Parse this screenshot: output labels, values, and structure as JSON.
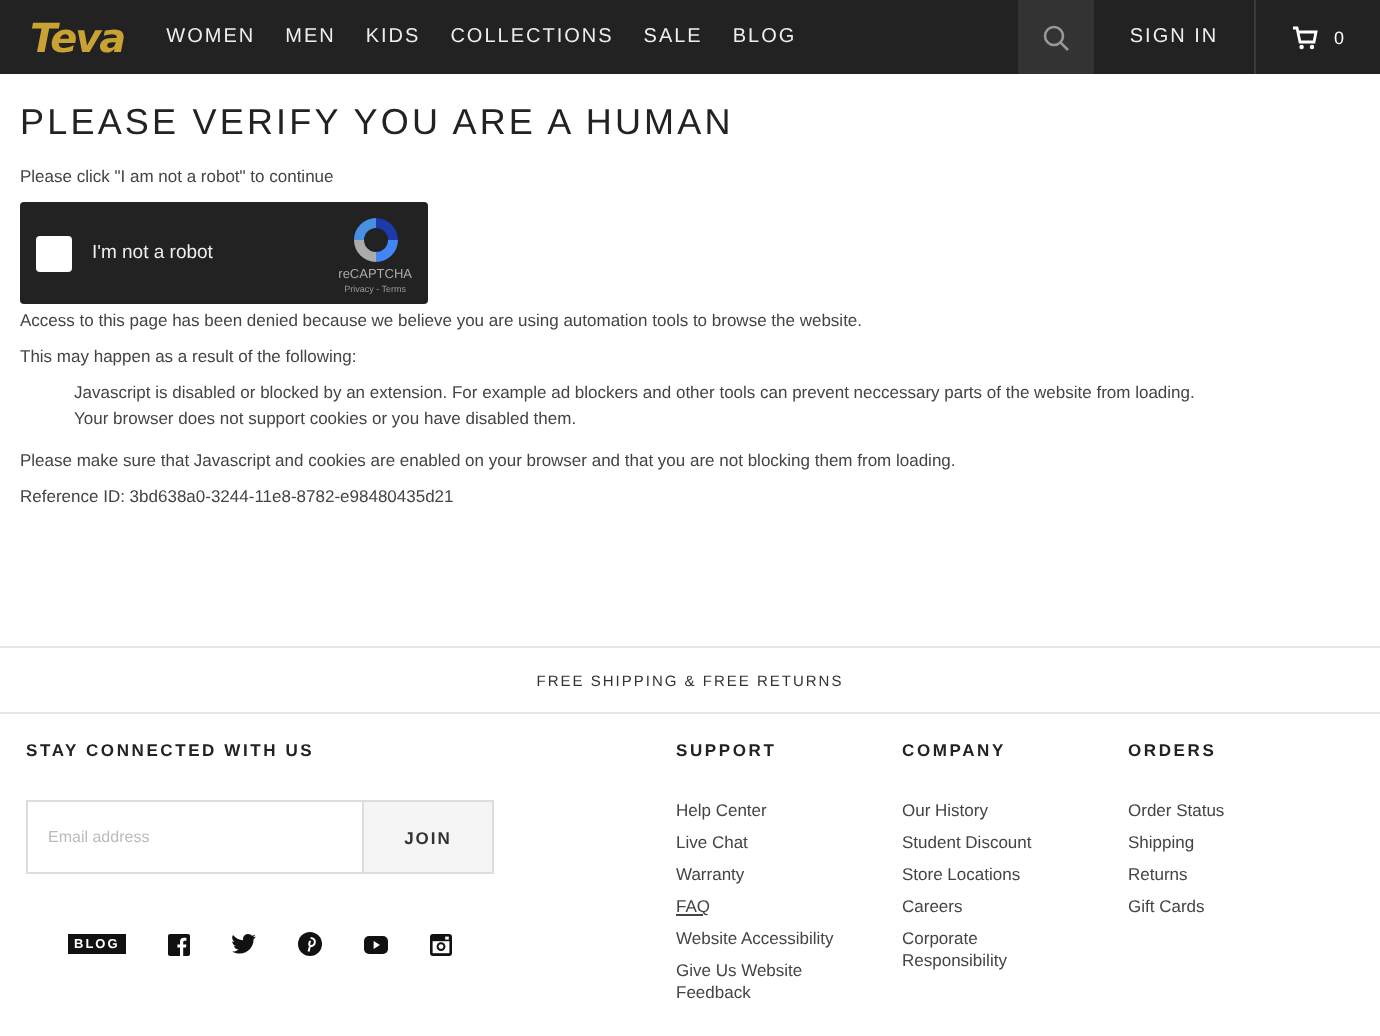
{
  "header": {
    "logo": "Teva",
    "nav": [
      "WOMEN",
      "MEN",
      "KIDS",
      "COLLECTIONS",
      "SALE",
      "BLOG"
    ],
    "sign_in": "SIGN IN",
    "cart_count": "0"
  },
  "main": {
    "title": "PLEASE VERIFY YOU ARE A HUMAN",
    "instruction": "Please click \"I am not a robot\" to continue",
    "captcha": {
      "label": "I'm not a robot",
      "checked": false,
      "brand": "reCAPTCHA",
      "links": "Privacy - Terms"
    },
    "denied": "Access to this page has been denied because we believe you are using automation tools to browse the website.",
    "reasons_intro": "This may happen as a result of the following:",
    "reasons": [
      "Javascript is disabled or blocked by an extension. For example ad blockers and other tools can prevent neccessary parts of the website from loading.",
      "Your browser does not support cookies or you have disabled them."
    ],
    "advice": "Please make sure that Javascript and cookies are enabled on your browser and that you are not blocking them from loading.",
    "reference": "Reference ID: 3bd638a0-3244-11e8-8782-e98480435d21"
  },
  "banner": "FREE SHIPPING & FREE RETURNS",
  "footer": {
    "newsletter": {
      "heading": "STAY CONNECTED WITH US",
      "placeholder": "Email address",
      "button": "JOIN"
    },
    "social": {
      "blog_badge": "BLOG"
    },
    "columns": [
      {
        "heading": "SUPPORT",
        "links": [
          {
            "label": "Help Center",
            "underlined": false
          },
          {
            "label": "Live Chat",
            "underlined": false
          },
          {
            "label": "Warranty",
            "underlined": false
          },
          {
            "label": "FAQ",
            "underlined": true
          },
          {
            "label": "Website Accessibility",
            "underlined": false
          },
          {
            "label": "Give Us Website Feedback",
            "underlined": false
          }
        ]
      },
      {
        "heading": "COMPANY",
        "links": [
          {
            "label": "Our History",
            "underlined": false
          },
          {
            "label": "Student Discount",
            "underlined": false
          },
          {
            "label": "Store Locations",
            "underlined": false
          },
          {
            "label": "Careers",
            "underlined": false
          },
          {
            "label": "Corporate Responsibility",
            "underlined": false
          }
        ]
      },
      {
        "heading": "ORDERS",
        "links": [
          {
            "label": "Order Status",
            "underlined": false
          },
          {
            "label": "Shipping",
            "underlined": false
          },
          {
            "label": "Returns",
            "underlined": false
          },
          {
            "label": "Gift Cards",
            "underlined": false
          }
        ]
      }
    ]
  }
}
